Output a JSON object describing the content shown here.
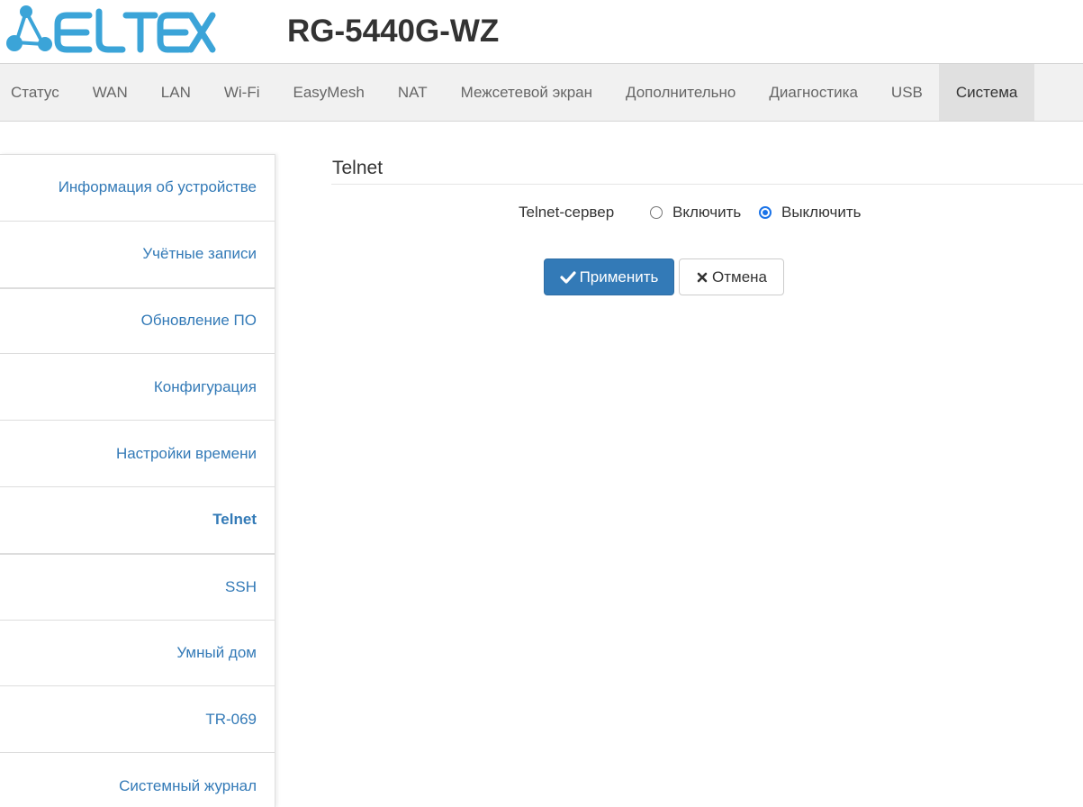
{
  "header": {
    "model": "RG-5440G-WZ",
    "logo_icon": "eltex-logo-icon",
    "brand_color": "#3ba4d8"
  },
  "topnav": {
    "items": [
      {
        "label": "Статус"
      },
      {
        "label": "WAN"
      },
      {
        "label": "LAN"
      },
      {
        "label": "Wi-Fi"
      },
      {
        "label": "EasyMesh"
      },
      {
        "label": "NAT"
      },
      {
        "label": "Межсетевой экран"
      },
      {
        "label": "Дополнительно"
      },
      {
        "label": "Диагностика"
      },
      {
        "label": "USB"
      },
      {
        "label": "Система",
        "active": true
      }
    ]
  },
  "sidebar": {
    "items": [
      {
        "label": "Информация об устройстве"
      },
      {
        "label": "Учётные записи"
      },
      {
        "label": "Обновление ПО"
      },
      {
        "label": "Конфигурация"
      },
      {
        "label": "Настройки времени"
      },
      {
        "label": "Telnet",
        "active": true
      },
      {
        "label": "SSH"
      },
      {
        "label": "Умный дом"
      },
      {
        "label": "TR-069"
      },
      {
        "label": "Системный журнал"
      }
    ]
  },
  "main": {
    "title": "Telnet",
    "field_label": "Telnet-сервер",
    "options": [
      {
        "label": "Включить",
        "checked": false
      },
      {
        "label": "Выключить",
        "checked": true
      }
    ],
    "apply_label": "Применить",
    "cancel_label": "Отмена",
    "apply_icon": "check-icon",
    "cancel_icon": "close-icon",
    "accent_color": "#337ab7"
  }
}
